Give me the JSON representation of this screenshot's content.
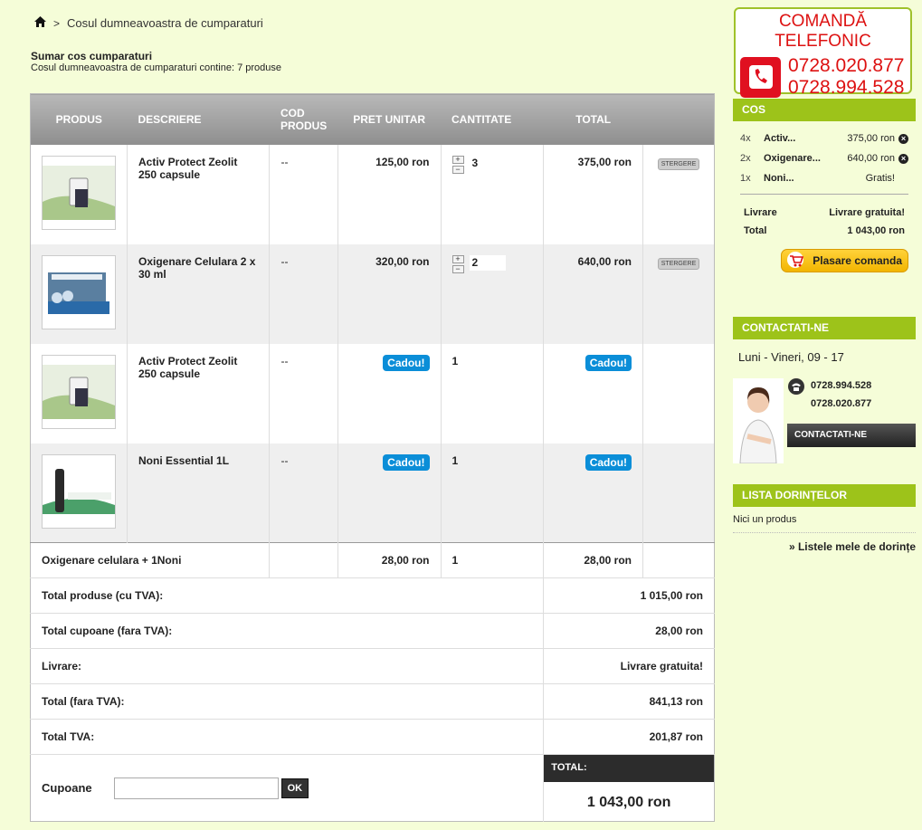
{
  "breadcrumb": {
    "separator": ">",
    "current": "Cosul dumneavoastra de cumparaturi"
  },
  "summary": {
    "title": "Sumar cos cumparaturi",
    "subtitle": "Cosul dumneavoastra de cumparaturi contine: 7 produse"
  },
  "table": {
    "headers": {
      "produs": "PRODUS",
      "descriere": "DESCRIERE",
      "cod_produs": "COD PRODUS",
      "pret_unitar": "PRET UNITAR",
      "cantitate": "CANTITATE",
      "total": "TOTAL"
    },
    "items": [
      {
        "name": "Activ Protect Zeolit 250 capsule",
        "code": "--",
        "price": "125,00 ron",
        "qty": "3",
        "total": "375,00 ron",
        "delete": "STERGERE"
      },
      {
        "name": "Oxigenare Celulara 2 x 30 ml",
        "code": "--",
        "price": "320,00 ron",
        "qty": "2",
        "total": "640,00 ron",
        "delete": "STERGERE"
      },
      {
        "name": "Activ Protect Zeolit 250 capsule",
        "code": "--",
        "price": "Cadou!",
        "qty": "1",
        "total": "Cadou!"
      },
      {
        "name": "Noni Essential 1L",
        "code": "--",
        "price": "Cadou!",
        "qty": "1",
        "total": "Cadou!"
      }
    ],
    "discount": {
      "name": "Oxigenare celulara + 1Noni",
      "price": "28,00 ron",
      "qty": "1",
      "total": "28,00 ron"
    },
    "summary_rows": [
      {
        "label": "Total produse (cu TVA):",
        "value": "1 015,00 ron"
      },
      {
        "label": "Total cupoane (fara TVA):",
        "value": "28,00 ron"
      },
      {
        "label": "Livrare:",
        "value": "Livrare gratuita!"
      },
      {
        "label": "Total (fara TVA):",
        "value": "841,13 ron"
      },
      {
        "label": "Total TVA:",
        "value": "201,87 ron"
      }
    ],
    "coupon": {
      "label": "Cupoane",
      "placeholder": "",
      "ok_label": "OK"
    },
    "grand_total": {
      "label": "TOTAL:",
      "value": "1 043,00 ron"
    }
  },
  "sidebar": {
    "phone": {
      "title": "COMANDĂ TELEFONIC",
      "numbers": [
        "0728.020.877",
        "0728.994.528"
      ]
    },
    "cart": {
      "title": "COS",
      "items": [
        {
          "qty": "4x",
          "name": "Activ...",
          "price": "375,00 ron",
          "removable": true
        },
        {
          "qty": "2x",
          "name": "Oxigenare...",
          "price": "640,00 ron",
          "removable": true
        },
        {
          "qty": "1x",
          "name": "Noni...",
          "price": "Gratis!",
          "removable": false
        }
      ],
      "shipping_label": "Livrare",
      "shipping_value": "Livrare gratuita!",
      "total_label": "Total",
      "total_value": "1 043,00 ron",
      "order_button": "Plasare comanda"
    },
    "contact": {
      "title": "CONTACTATI-NE",
      "hours": "Luni - Vineri, 09 - 17",
      "phones": [
        "0728.994.528",
        "0728.020.877"
      ],
      "button": "CONTACTATI-NE"
    },
    "wishlist": {
      "title": "LISTA DORINȚELOR",
      "empty": "Nici un produs",
      "link": "» Listele mele de dorințe"
    }
  }
}
